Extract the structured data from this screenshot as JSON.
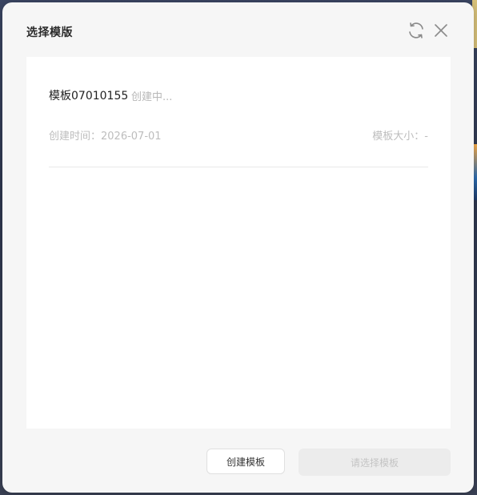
{
  "dialog": {
    "title": "选择模版"
  },
  "template": {
    "name": "模板07010155",
    "status": "创建中...",
    "time_label": "创建时间：",
    "time_value": "2026-07-01",
    "size_label": "模板大小：",
    "size_value": "-"
  },
  "footer": {
    "create_label": "创建模板",
    "select_label": "请选择模板"
  },
  "colors": {
    "dialog_bg": "#f6f6f6",
    "panel_bg": "#ffffff",
    "muted_text": "#bdbdbd",
    "disabled_btn": "#ececec"
  },
  "icons": {
    "refresh": "refresh-icon",
    "close": "close-icon"
  }
}
